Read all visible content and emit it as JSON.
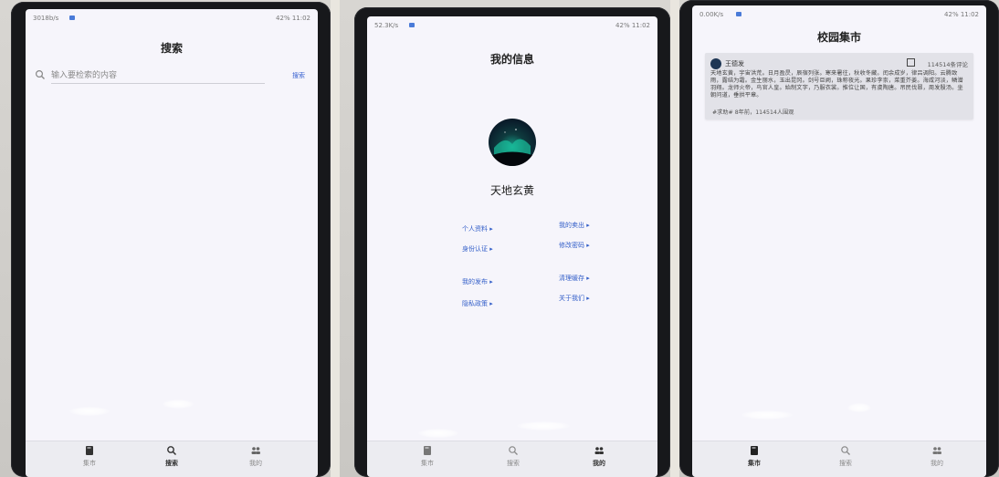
{
  "photos": [
    {
      "status_left": "3018b/s",
      "status_right": "42%  11:02",
      "title": "搜索",
      "search": {
        "placeholder": "输入要检索的内容",
        "button": "搜索"
      },
      "tabs": [
        {
          "label": "集市",
          "icon": "book-icon",
          "active": false
        },
        {
          "label": "搜索",
          "icon": "search-icon",
          "active": true
        },
        {
          "label": "我的",
          "icon": "people-icon",
          "active": false
        }
      ]
    },
    {
      "status_left": "52.3K/s",
      "status_right": "42%  11:02",
      "title": "我的信息",
      "username": "天地玄黄",
      "links_left": [
        "个人资料",
        "身份认证",
        "我的发布",
        "隐私政策"
      ],
      "links_right": [
        "我的卖出",
        "修改密码",
        "清理缓存",
        "关于我们"
      ],
      "tabs": [
        {
          "label": "集市",
          "icon": "book-icon",
          "active": false
        },
        {
          "label": "搜索",
          "icon": "search-icon",
          "active": false
        },
        {
          "label": "我的",
          "icon": "people-icon",
          "active": true
        }
      ]
    },
    {
      "status_left": "0.00K/s",
      "status_right": "42%  11:02",
      "title": "校园集市",
      "post": {
        "author": "王德发",
        "meta": "114514条评论",
        "content": "天地玄黄，宇宙洪荒。日月盈昃，辰宿列张。寒来暑往，秋收冬藏。闰余成岁，律吕调阳。云腾致雨，露结为霜。金生丽水，玉出昆冈。剑号巨阙，珠称夜光。果珍李柰，菜重芥姜。海咸河淡，鳞潜羽翔。龙师火帝，鸟官人皇。始制文字，乃服衣裳。推位让国，有虞陶唐。吊民伐罪，周发殷汤。坐朝问道，垂拱平章。",
        "footer": "#求助#  8年前，114514人围观"
      },
      "tabs": [
        {
          "label": "集市",
          "icon": "book-icon",
          "active": true
        },
        {
          "label": "搜索",
          "icon": "search-icon",
          "active": false
        },
        {
          "label": "我的",
          "icon": "people-icon",
          "active": false
        }
      ]
    }
  ]
}
